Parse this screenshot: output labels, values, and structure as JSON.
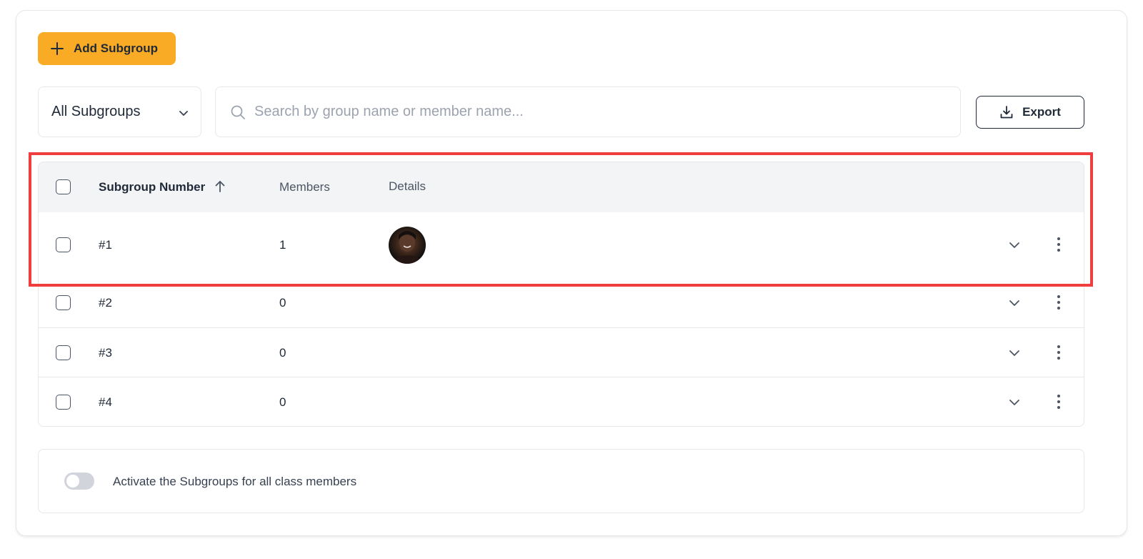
{
  "toolbar": {
    "add_label": "Add Subgroup",
    "filter_value": "All Subgroups",
    "search_placeholder": "Search by group name or member name...",
    "export_label": "Export"
  },
  "table": {
    "headers": {
      "number": "Subgroup Number",
      "members": "Members",
      "details": "Details"
    },
    "sort": "ascending",
    "rows": [
      {
        "number": "#1",
        "members": "1",
        "has_avatar": true
      },
      {
        "number": "#2",
        "members": "0",
        "has_avatar": false
      },
      {
        "number": "#3",
        "members": "0",
        "has_avatar": false
      },
      {
        "number": "#4",
        "members": "0",
        "has_avatar": false
      }
    ]
  },
  "footer": {
    "toggle_label": "Activate the Subgroups for all class members",
    "toggle_on": false
  },
  "colors": {
    "accent": "#f9ab25",
    "highlight": "#f03e3e",
    "header_bg": "#f3f4f6"
  },
  "icons": [
    "plus-icon",
    "chevron-down-icon",
    "search-icon",
    "download-icon",
    "arrow-up-icon",
    "kebab-icon"
  ]
}
